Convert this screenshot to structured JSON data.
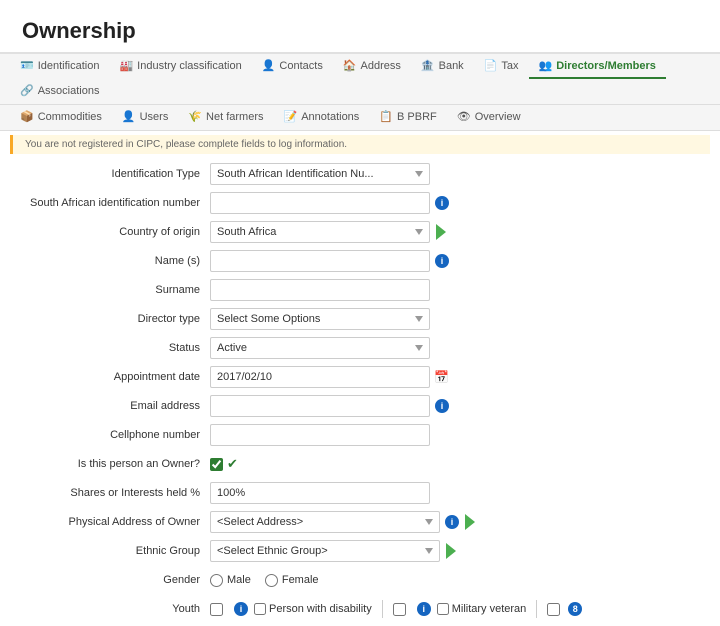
{
  "page": {
    "title": "Ownership"
  },
  "tabs_row1": [
    {
      "id": "identification",
      "label": "Identification",
      "icon": "🪪",
      "active": false
    },
    {
      "id": "industry",
      "label": "Industry classification",
      "icon": "🏭",
      "active": false
    },
    {
      "id": "contacts",
      "label": "Contacts",
      "icon": "👤",
      "active": false
    },
    {
      "id": "address",
      "label": "Address",
      "icon": "🏠",
      "active": false
    },
    {
      "id": "bank",
      "label": "Bank",
      "icon": "🏦",
      "active": false
    },
    {
      "id": "tax",
      "label": "Tax",
      "icon": "📄",
      "active": false
    },
    {
      "id": "directors",
      "label": "Directors/Members",
      "icon": "👥",
      "active": true
    },
    {
      "id": "associations",
      "label": "Associations",
      "icon": "🔗",
      "active": false
    }
  ],
  "tabs_row2": [
    {
      "id": "commodities",
      "label": "Commodities",
      "icon": "📦",
      "active": false
    },
    {
      "id": "users",
      "label": "Users",
      "icon": "👤",
      "active": false
    },
    {
      "id": "net_farmers",
      "label": "Net farmers",
      "icon": "🌾",
      "active": false
    },
    {
      "id": "annotations",
      "label": "Annotations",
      "icon": "📝",
      "active": false
    },
    {
      "id": "b_pbrf",
      "label": "B PBRF",
      "icon": "📋",
      "active": false
    },
    {
      "id": "overview",
      "label": "Overview",
      "icon": "👁",
      "active": false
    }
  ],
  "alert": {
    "text": "You are not registered in CIPC, please complete fields to log information."
  },
  "form": {
    "identification_type_label": "Identification Type",
    "identification_type_value": "South African Identification Nu...",
    "sa_id_label": "South African identification number",
    "sa_id_value": "",
    "country_label": "Country of origin",
    "country_value": "South Africa",
    "name_label": "Name (s)",
    "name_value": "",
    "surname_label": "Surname",
    "surname_value": "",
    "director_type_label": "Director type",
    "director_type_value": "Select Some Options",
    "status_label": "Status",
    "status_value": "Active",
    "appointment_label": "Appointment date",
    "appointment_value": "2017/02/10",
    "email_label": "Email address",
    "email_value": "",
    "cellphone_label": "Cellphone number",
    "cellphone_value": "",
    "is_owner_label": "Is this person an Owner?",
    "shares_label": "Shares or Interests held %",
    "shares_value": "100%",
    "physical_address_label": "Physical Address of Owner",
    "physical_address_placeholder": "<Select Address>",
    "ethnic_group_label": "Ethnic Group",
    "ethnic_group_placeholder": "<Select Ethnic Group>",
    "gender_label": "Gender",
    "gender_male": "Male",
    "gender_female": "Female",
    "youth_label": "Youth",
    "youth_items": [
      {
        "id": "person_disability",
        "label": "Person with disability"
      },
      {
        "id": "military_veteran",
        "label": "Military veteran"
      }
    ],
    "youth_num": "8"
  }
}
